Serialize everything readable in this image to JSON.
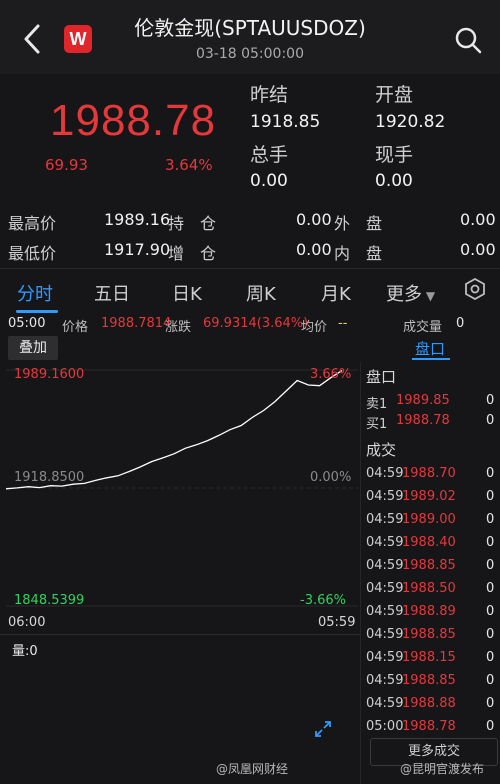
{
  "header": {
    "title": "伦敦金现(SPTAUUSDOZ)",
    "datetime": "03-18 05:00:00",
    "logo_letter": "W"
  },
  "quote": {
    "price": "1988.78",
    "change": "69.93",
    "change_pct": "3.64%",
    "prev_close_label": "昨结",
    "prev_close": "1918.85",
    "open_label": "开盘",
    "open": "1920.82",
    "total_vol_label": "总手",
    "total_vol": "0.00",
    "current_vol_label": "现手",
    "current_vol": "0.00"
  },
  "stats": {
    "high_label": "最高价",
    "high": "1989.16",
    "low_label": "最低价",
    "low": "1917.90",
    "open_int_label": "持　仓",
    "open_int": "0.00",
    "inc_label": "增　仓",
    "inc": "0.00",
    "outer_label": "外　盘",
    "outer": "0.00",
    "inner_label": "内　盘",
    "inner": "0.00"
  },
  "tabs": [
    "分时",
    "五日",
    "日K",
    "周K",
    "月K",
    "更多"
  ],
  "info_bar": {
    "time": "05:00",
    "price_label": "价格",
    "price": "1988.7814",
    "change_label": "涨跌",
    "change": "69.9314(3.64%)",
    "avg_label": "均价",
    "avg": "--",
    "volume_label": "成交量",
    "volume": "0"
  },
  "chart_controls": {
    "stack_button": "叠加",
    "side_tab": "盘口"
  },
  "chart_data": {
    "type": "line",
    "x_start": "06:00",
    "x_end": "05:59",
    "y_top": "1989.1600",
    "y_mid": "1918.8500",
    "y_bottom": "1848.5399",
    "pct_top": "3.66%",
    "pct_mid": "0.00%",
    "pct_bottom": "-3.66%",
    "ylim": [
      1848.5399,
      1989.16
    ],
    "series": [
      {
        "values": [
          1918.4,
          1918.9,
          1919.6,
          1919.1,
          1920.2,
          1920.0,
          1921.1,
          1921.6,
          1923.4,
          1924.9,
          1926.1,
          1928.7,
          1931.4,
          1934.6,
          1936.8,
          1939.2,
          1942.5,
          1944.6,
          1947.1,
          1950.2,
          1953.6,
          1956.1,
          1960.9,
          1965.0,
          1970.3,
          1976.6,
          1982.9,
          1980.2,
          1979.8,
          1984.6,
          1988.78
        ]
      }
    ],
    "color": "#ffffff"
  },
  "volume_label": "量:0",
  "order_book": {
    "title": "盘口",
    "asks": [
      {
        "label": "卖1",
        "price": "1989.85",
        "vol": "0"
      }
    ],
    "bids": [
      {
        "label": "买1",
        "price": "1988.78",
        "vol": "0"
      }
    ]
  },
  "trades": {
    "title": "成交",
    "rows": [
      {
        "time": "04:59",
        "price": "1988.70",
        "vol": "0"
      },
      {
        "time": "04:59",
        "price": "1989.02",
        "vol": "0"
      },
      {
        "time": "04:59",
        "price": "1989.00",
        "vol": "0"
      },
      {
        "time": "04:59",
        "price": "1988.40",
        "vol": "0"
      },
      {
        "time": "04:59",
        "price": "1988.85",
        "vol": "0"
      },
      {
        "time": "04:59",
        "price": "1988.50",
        "vol": "0"
      },
      {
        "time": "04:59",
        "price": "1988.89",
        "vol": "0"
      },
      {
        "time": "04:59",
        "price": "1988.85",
        "vol": "0"
      },
      {
        "time": "04:59",
        "price": "1988.15",
        "vol": "0"
      },
      {
        "time": "04:59",
        "price": "1988.85",
        "vol": "0"
      },
      {
        "time": "04:59",
        "price": "1988.88",
        "vol": "0"
      },
      {
        "time": "05:00",
        "price": "1988.78",
        "vol": "0"
      }
    ],
    "more_label": "更多成交"
  },
  "watermarks": {
    "left": "@凤凰网财经",
    "right": "@昆明官渡发布"
  },
  "colors": {
    "up": "#e5383b",
    "down": "#2bd65b",
    "accent": "#2f9bff",
    "avg": "#d9d94a"
  },
  "icons": {
    "back": "chevron-left-icon",
    "search": "search-icon",
    "settings": "hexagon-settings-icon",
    "expand": "expand-icon"
  }
}
